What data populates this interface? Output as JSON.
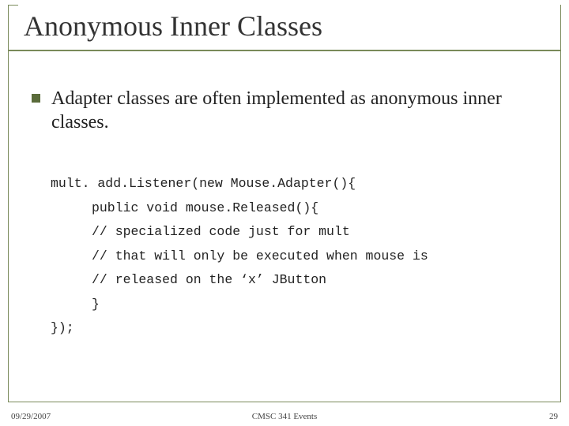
{
  "title": "Anonymous Inner Classes",
  "body": "Adapter classes are often implemented as anonymous inner classes.",
  "code": {
    "l1": "mult. add.Listener(new Mouse.Adapter(){",
    "l2": "public void mouse.Released(){",
    "l3": "// specialized code just for mult",
    "l4": "// that will only be executed when mouse is",
    "l5": "// released on the ‘x’ JButton",
    "l6": "}",
    "l7": "});"
  },
  "footer": {
    "date": "09/29/2007",
    "center": "CMSC 341 Events",
    "page": "29"
  }
}
